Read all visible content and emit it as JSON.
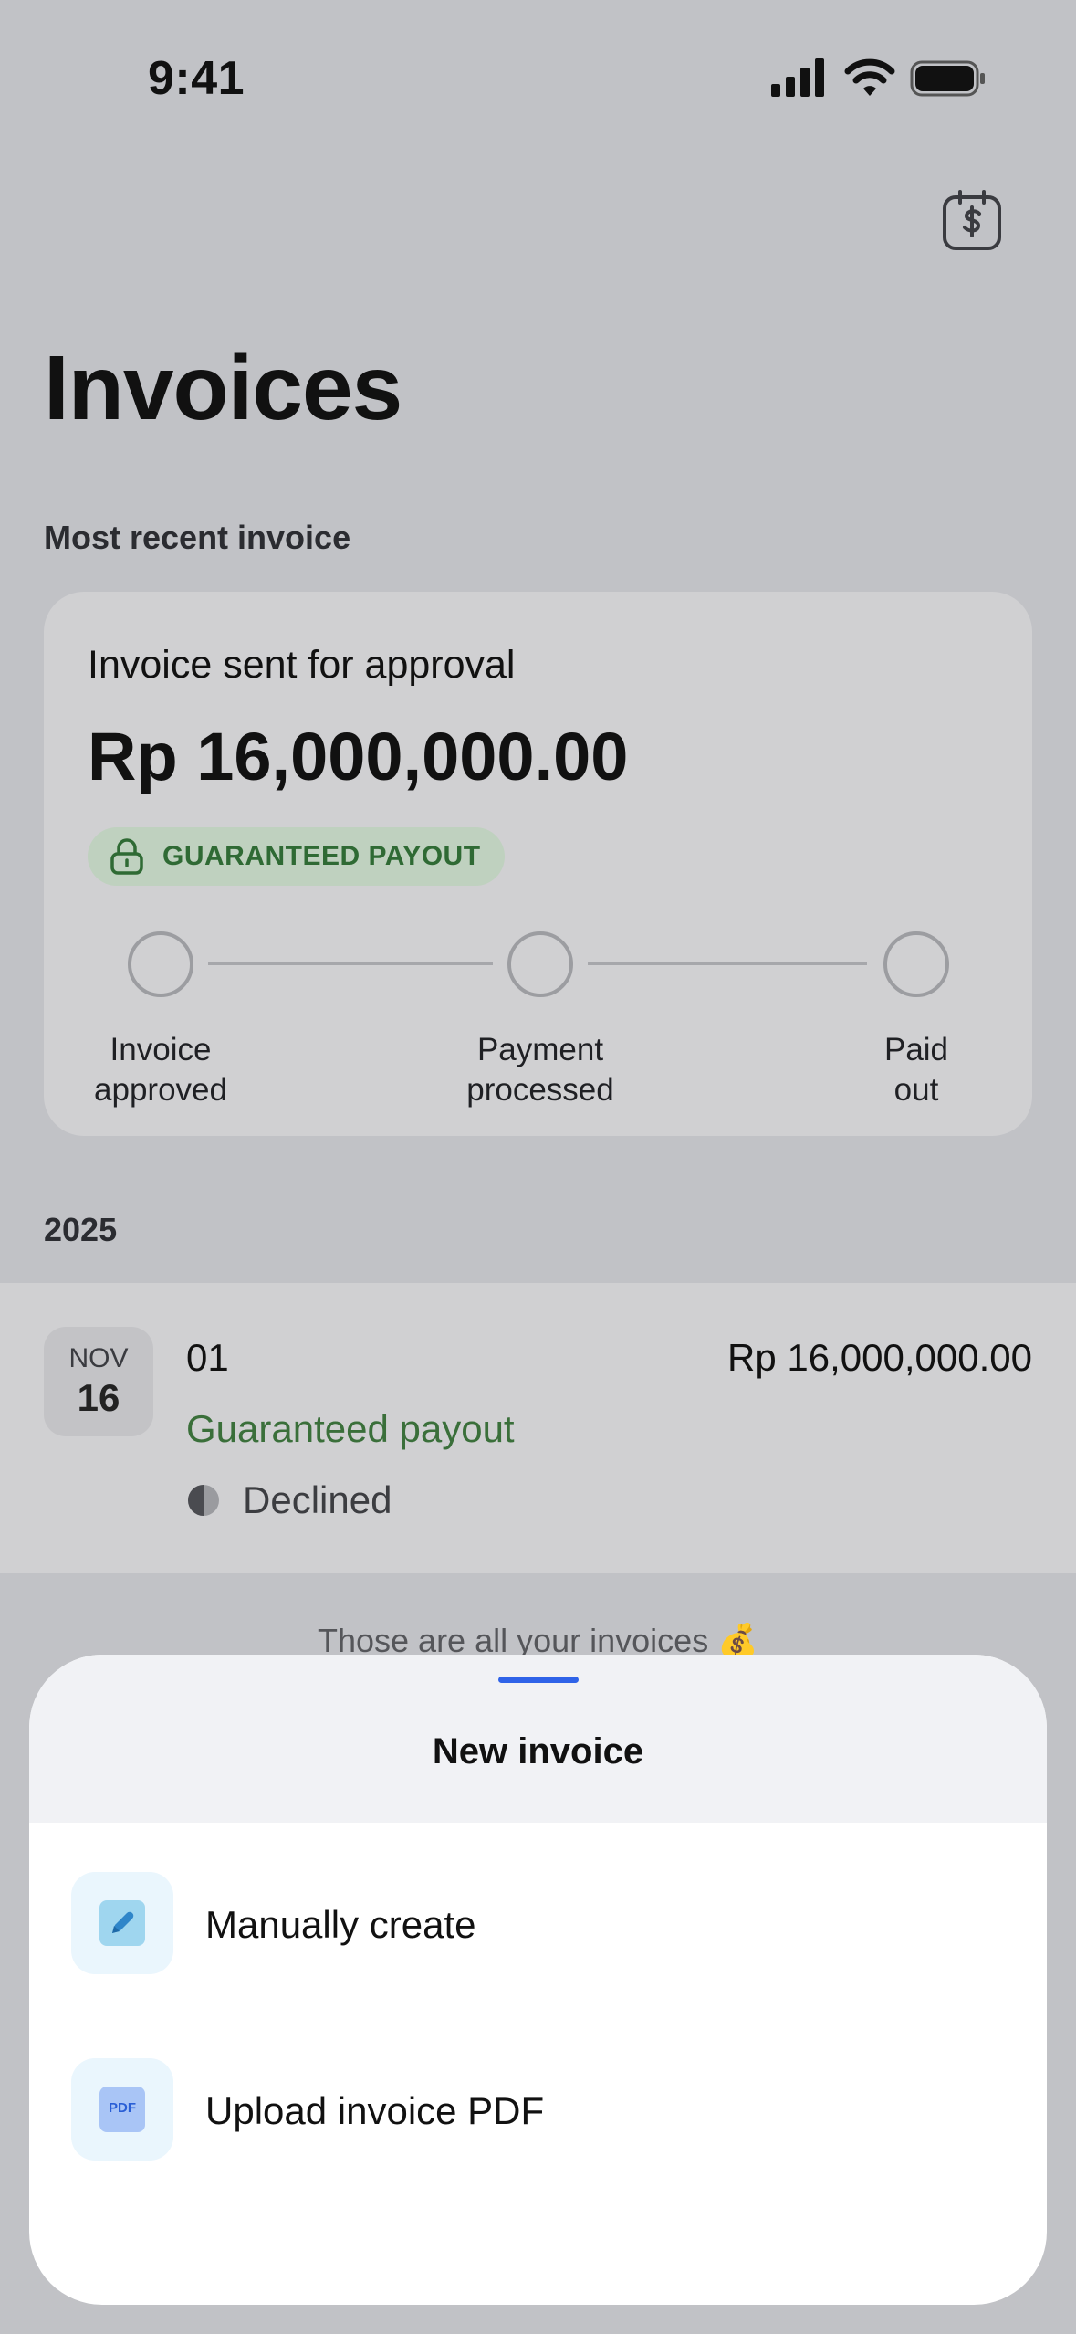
{
  "status_bar": {
    "time": "9:41"
  },
  "header": {
    "title": "Invoices",
    "action_icon": "calendar-dollar-icon"
  },
  "recent_section": {
    "label": "Most recent invoice",
    "card": {
      "status": "Invoice sent for approval",
      "amount": "Rp 16,000,000.00",
      "badge": "GUARANTEED PAYOUT",
      "steps": [
        {
          "line1": "Invoice",
          "line2": "approved"
        },
        {
          "line1": "Payment",
          "line2": "processed"
        },
        {
          "line1": "Paid",
          "line2": "out"
        }
      ]
    }
  },
  "list": {
    "year": "2025",
    "items": [
      {
        "month": "NOV",
        "day": "16",
        "number": "01",
        "amount": "Rp 16,000,000.00",
        "type": "Guaranteed payout",
        "status": "Declined"
      }
    ],
    "end_note": "Those are all your invoices 💰"
  },
  "sheet": {
    "title": "New invoice",
    "options": [
      {
        "label": "Manually create",
        "icon": "pencil-icon"
      },
      {
        "label": "Upload invoice PDF",
        "icon": "pdf-icon",
        "icon_text": "PDF"
      }
    ]
  },
  "colors": {
    "accent": "#2f63e8",
    "badge_green": "#2f6a34",
    "payout_green": "#3a6f3a",
    "overlay_bg": "#c1c2c6"
  }
}
